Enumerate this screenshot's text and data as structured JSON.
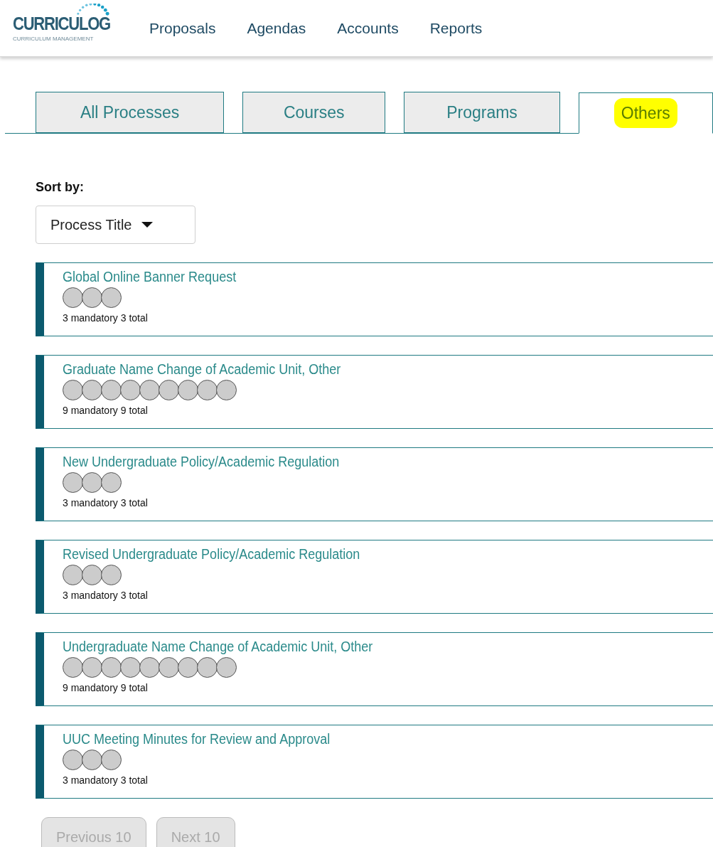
{
  "logo": {
    "name": "CURRICULOG",
    "tagline": "CURRICULUM MANAGEMENT"
  },
  "nav": [
    "Proposals",
    "Agendas",
    "Accounts",
    "Reports"
  ],
  "tabs": [
    {
      "label": "All Processes",
      "selected": false,
      "highlighted": false
    },
    {
      "label": "Courses",
      "selected": false,
      "highlighted": false
    },
    {
      "label": "Programs",
      "selected": false,
      "highlighted": false
    },
    {
      "label": "Others",
      "selected": true,
      "highlighted": true
    }
  ],
  "sort": {
    "label": "Sort by:",
    "value": "Process Title"
  },
  "processes": [
    {
      "title": "Global Online Banner Request",
      "steps": [
        {
          "completed": false
        },
        {
          "completed": false
        },
        {
          "completed": false
        }
      ],
      "summary": "3 mandatory 3 total"
    },
    {
      "title": "Graduate Name Change of Academic Unit, Other",
      "steps": [
        {
          "completed": false
        },
        {
          "completed": false
        },
        {
          "completed": false
        },
        {
          "completed": false
        },
        {
          "completed": false
        },
        {
          "completed": false
        },
        {
          "completed": false
        },
        {
          "completed": false
        },
        {
          "completed": false
        }
      ],
      "summary": "9 mandatory 9 total"
    },
    {
      "title": "New Undergraduate Policy/Academic Regulation",
      "steps": [
        {
          "completed": false
        },
        {
          "completed": false
        },
        {
          "completed": false
        }
      ],
      "summary": "3 mandatory 3 total"
    },
    {
      "title": "Revised Undergraduate Policy/Academic Regulation",
      "steps": [
        {
          "completed": false
        },
        {
          "completed": false
        },
        {
          "completed": false
        }
      ],
      "summary": "3 mandatory 3 total"
    },
    {
      "title": "Undergraduate Name Change of Academic Unit, Other",
      "steps": [
        {
          "completed": false
        },
        {
          "completed": false
        },
        {
          "completed": false
        },
        {
          "completed": false
        },
        {
          "completed": false
        },
        {
          "completed": false
        },
        {
          "completed": false
        },
        {
          "completed": false
        },
        {
          "completed": false
        }
      ],
      "summary": "9 mandatory 9 total"
    },
    {
      "title": "UUC Meeting Minutes for Review and Approval",
      "steps": [
        {
          "completed": false
        },
        {
          "completed": false
        },
        {
          "completed": false
        }
      ],
      "summary": "3 mandatory 3 total"
    }
  ],
  "pager": [
    {
      "label": "Previous 10",
      "disabled": true
    },
    {
      "label": "Next 10",
      "disabled": true
    }
  ]
}
